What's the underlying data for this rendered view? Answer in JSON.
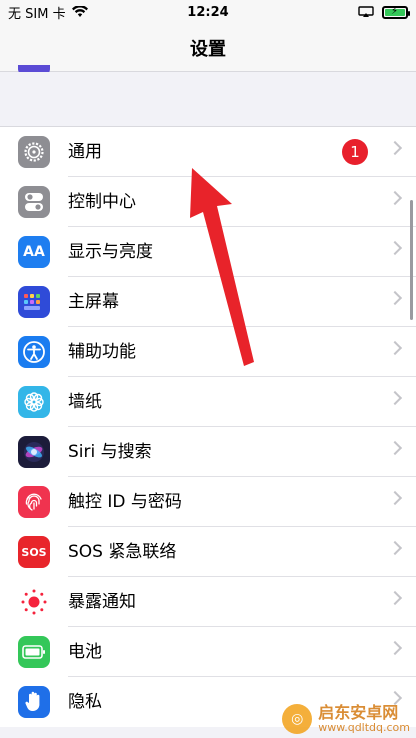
{
  "status_bar": {
    "carrier": "无 SIM 卡",
    "time": "12:24"
  },
  "nav": {
    "title": "设置"
  },
  "settings": [
    {
      "label": "通用",
      "icon": "gear-icon",
      "color": "#8e8e93",
      "badge": "1"
    },
    {
      "label": "控制中心",
      "icon": "toggle-icon",
      "color": "#8e8e93"
    },
    {
      "label": "显示与亮度",
      "icon": "text-size-icon",
      "icon_text": "AA",
      "color": "#1e7ef0"
    },
    {
      "label": "主屏幕",
      "icon": "home-grid-icon",
      "color": "#2f4bd8"
    },
    {
      "label": "辅助功能",
      "icon": "accessibility-icon",
      "color": "#1a7cf0"
    },
    {
      "label": "墙纸",
      "icon": "flower-icon",
      "color": "#33b6e8"
    },
    {
      "label": "Siri 与搜索",
      "icon": "siri-icon",
      "color": "#1c1c3a"
    },
    {
      "label": "触控 ID 与密码",
      "icon": "fingerprint-icon",
      "color": "#f0334f"
    },
    {
      "label": "SOS 紧急联络",
      "icon": "sos-icon",
      "icon_text": "SOS",
      "color": "#e8252b"
    },
    {
      "label": "暴露通知",
      "icon": "exposure-dots-icon",
      "color": "#ffffff"
    },
    {
      "label": "电池",
      "icon": "battery-icon",
      "color": "#34c759"
    },
    {
      "label": "隐私",
      "icon": "hand-icon",
      "color": "#1f6fe8"
    }
  ],
  "watermark": {
    "title": "启东安卓网",
    "url": "www.qdltdq.com"
  },
  "colors": {
    "annotation_arrow": "#e8232a",
    "badge": "#e8202c"
  }
}
